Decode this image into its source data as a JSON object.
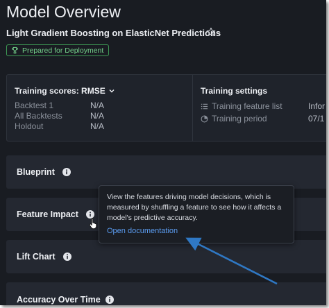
{
  "header": {
    "title": "Model Overview",
    "model_name": "Light Gradient Boosting on ElasticNet Predictions",
    "badge": "Prepared for Deployment"
  },
  "training_scores": {
    "header": "Training scores: RMSE",
    "rows": [
      {
        "label": "Backtest 1",
        "value": "N/A"
      },
      {
        "label": "All Backtests",
        "value": "N/A"
      },
      {
        "label": "Holdout",
        "value": "N/A"
      }
    ]
  },
  "training_settings": {
    "title": "Training settings",
    "rows": [
      {
        "label": "Training feature list",
        "value": "Infor",
        "icon": "list-icon"
      },
      {
        "label": "Training period",
        "value": "07/1",
        "icon": "pie-icon"
      }
    ]
  },
  "sections": [
    {
      "label": "Blueprint"
    },
    {
      "label": "Feature Impact"
    },
    {
      "label": "Lift Chart"
    },
    {
      "label": "Accuracy Over Time"
    }
  ],
  "tooltip": {
    "text": "View the features driving model decisions, which is measured by shuffling a feature to see how it affects a model's predictive accuracy.",
    "link": "Open documentation"
  },
  "colors": {
    "background": "#191c22",
    "badge_green": "#74d08a",
    "link_blue": "#5b9cf0",
    "annotation_arrow": "#2f78c4"
  }
}
